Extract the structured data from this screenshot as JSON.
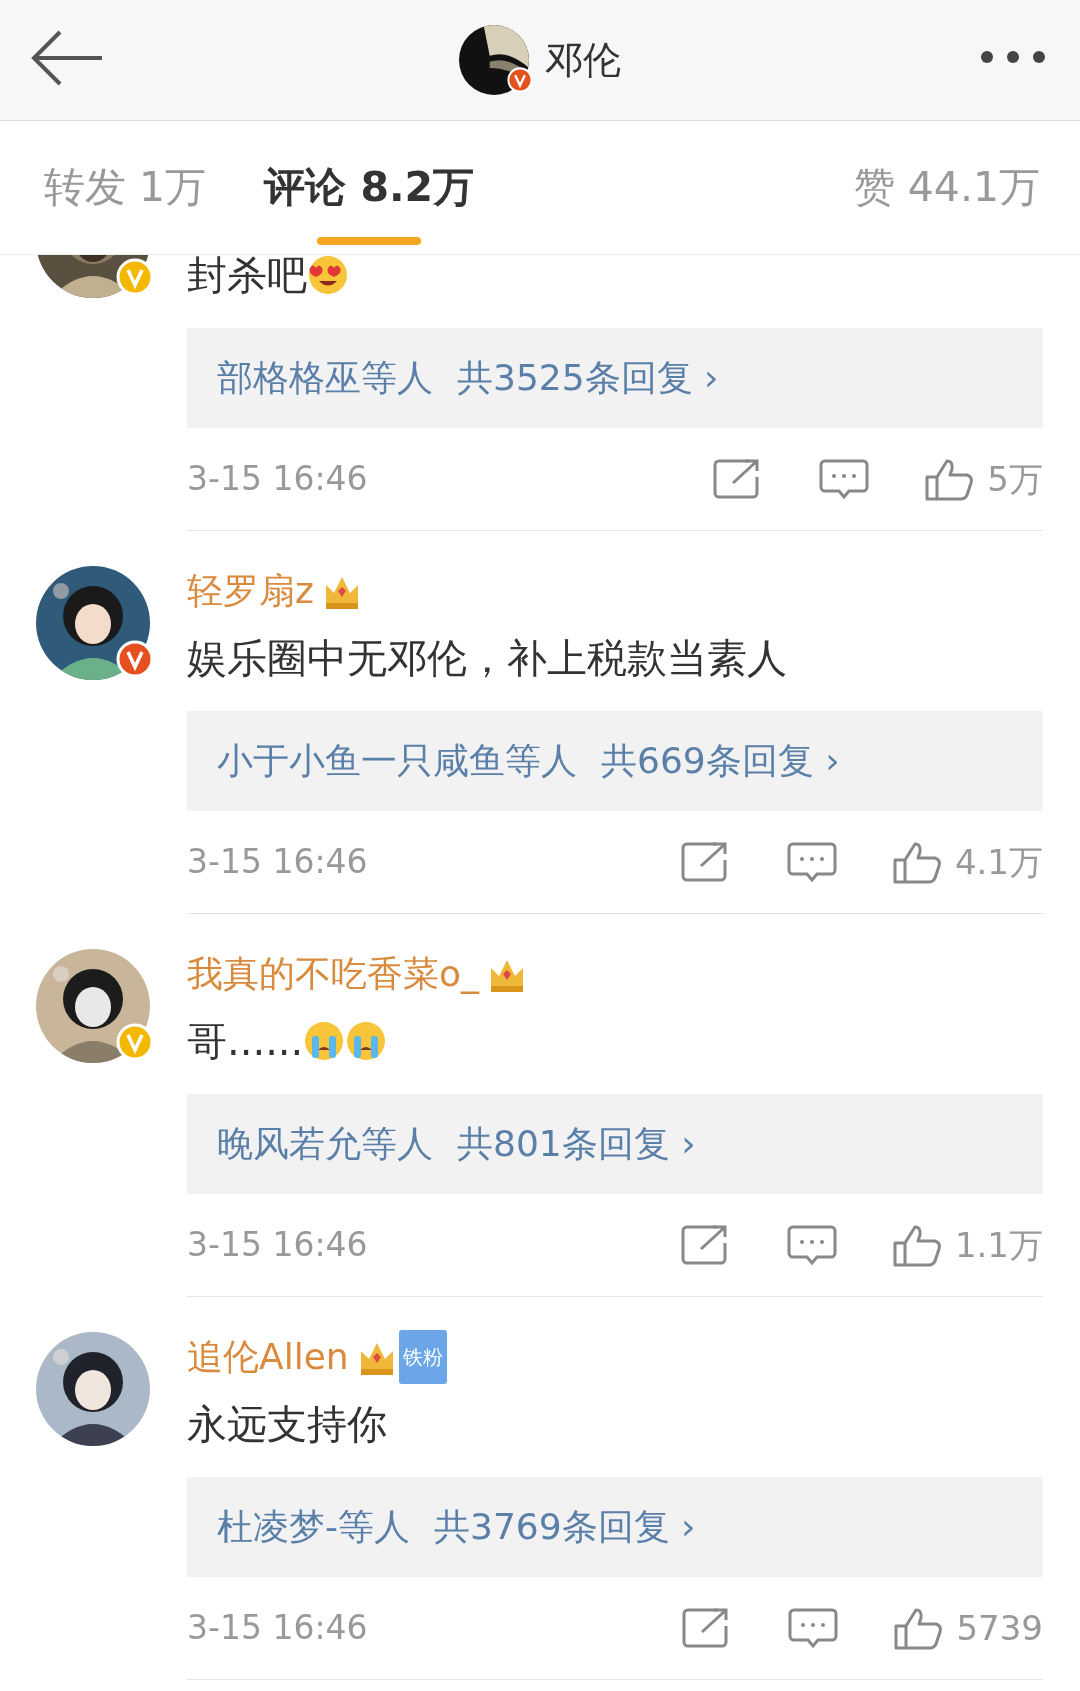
{
  "header": {
    "title": "邓伦",
    "verified": true
  },
  "tabs": [
    {
      "label": "转发 1万",
      "selected": false
    },
    {
      "label": "评论 8.2万",
      "selected": true
    },
    {
      "label": "赞 44.1万",
      "selected": false
    }
  ],
  "comments": [
    {
      "verified": true,
      "color": "#f5b800",
      "text": "封杀吧",
      "emojis": [
        {
          "kind": "heart_eyes"
        }
      ],
      "replies": {
        "users": "部格格巫等人",
        "count": "共3525条回复 ›"
      },
      "time": "3-15 16:46",
      "likes": "5万"
    },
    {
      "name": "轻罗扇z",
      "crown": true,
      "verified": true,
      "color": "#e4501e",
      "text": "娱乐圈中无邓伦，补上税款当素人",
      "replies": {
        "users": "小于小鱼一只咸鱼等人",
        "count": "共669条回复 ›"
      },
      "time": "3-15 16:46",
      "likes": "4.1万"
    },
    {
      "name": "我真的不吃香菜o_",
      "crown": true,
      "verified": true,
      "color": "#f5b800",
      "text": "哥......",
      "emojis": [
        {
          "kind": "crying"
        },
        {
          "kind": "crying"
        }
      ],
      "replies": {
        "users": "晚风若允等人",
        "count": "共801条回复 ›"
      },
      "time": "3-15 16:46",
      "likes": "1.1万"
    },
    {
      "name": "追伦Allen",
      "crown": true,
      "verified": false,
      "fan_tag": "铁粉",
      "text": "永远支持你",
      "replies": {
        "users": "杜凌梦-等人",
        "count": "共3769条回复 ›"
      },
      "time": "3-15 16:46",
      "likes": "5739"
    }
  ]
}
